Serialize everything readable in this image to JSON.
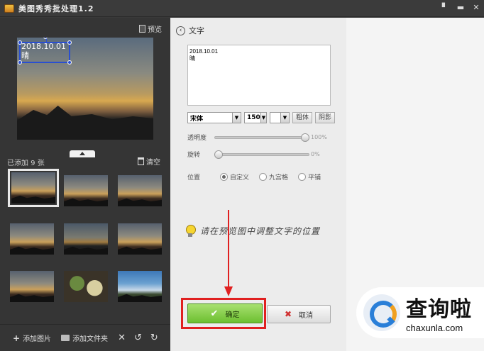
{
  "window": {
    "title": "美图秀秀批处理1.2"
  },
  "left_panel": {
    "preview_label": "预览",
    "preview_overlay": [
      "2018.10.01",
      "晴"
    ],
    "added_count": "已添加 9 张",
    "clear_label": "清空",
    "thumbnails": [
      "sunset",
      "sunset",
      "sunset",
      "sunset",
      "dark",
      "sunset",
      "sunset",
      "food",
      "blue"
    ],
    "toolbar": {
      "add_image": "添加图片",
      "add_folder": "添加文件夹"
    }
  },
  "middle_panel": {
    "section_title": "文字",
    "text_content": "2018.10.01\n晴",
    "font_name": "宋体",
    "font_size": "150",
    "bold_label": "粗体",
    "shadow_label": "阴影",
    "opacity": {
      "label": "透明度",
      "value": "100%",
      "fraction": 1.0
    },
    "rotation": {
      "label": "旋转",
      "value": "0%",
      "fraction": 0.0
    },
    "position": {
      "label": "位置",
      "options": [
        "自定义",
        "九宫格",
        "平铺"
      ],
      "selected": "自定义"
    },
    "hint": "请在预览图中调整文字的位置",
    "ok_label": "确定",
    "cancel_label": "取消"
  },
  "watermark": {
    "cn": "查询啦",
    "en": "chaxunla.com"
  },
  "colors": {
    "accent_green": "#6cbf30",
    "highlight_red": "#e02020",
    "selection_blue": "#2a4fd0"
  }
}
